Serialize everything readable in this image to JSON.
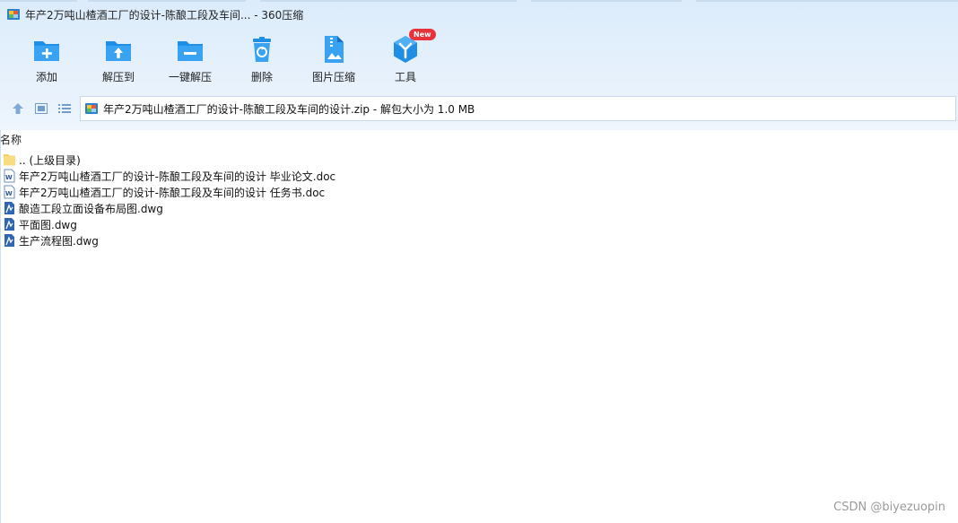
{
  "window": {
    "title": "年产2万吨山楂酒工厂的设计-陈酿工段及车间... - 360压缩"
  },
  "toolbar": {
    "items": [
      {
        "label": "添加",
        "icon": "folder-add-icon"
      },
      {
        "label": "解压到",
        "icon": "folder-extract-icon"
      },
      {
        "label": "一键解压",
        "icon": "folder-oneclick-extract-icon"
      },
      {
        "label": "删除",
        "icon": "recycle-bin-icon"
      },
      {
        "label": "图片压缩",
        "icon": "image-compress-icon"
      },
      {
        "label": "工具",
        "icon": "tools-cube-icon",
        "badge": "New"
      }
    ]
  },
  "navbar": {
    "address": "年产2万吨山楂酒工厂的设计-陈酿工段及车间的设计.zip - 解包大小为 1.0 MB"
  },
  "list": {
    "header_name": "名称",
    "rows": [
      {
        "name": ".. (上级目录)",
        "type": "parent-folder"
      },
      {
        "name": "年产2万吨山楂酒工厂的设计-陈酿工段及车间的设计 毕业论文.doc",
        "type": "doc"
      },
      {
        "name": "年产2万吨山楂酒工厂的设计-陈酿工段及车间的设计 任务书.doc",
        "type": "doc"
      },
      {
        "name": "酿造工段立面设备布局图.dwg",
        "type": "dwg"
      },
      {
        "name": "平面图.dwg",
        "type": "dwg"
      },
      {
        "name": "生产流程图.dwg",
        "type": "dwg"
      }
    ]
  },
  "watermark": "CSDN @biyezuopin",
  "colors": {
    "accent_blue": "#1e8ee6",
    "badge_red": "#e8333c"
  }
}
